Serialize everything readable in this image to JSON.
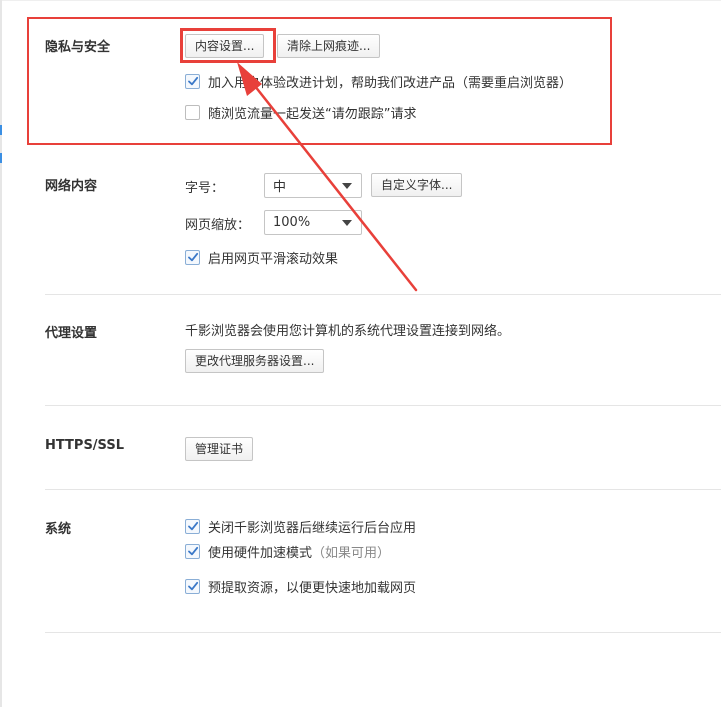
{
  "privacy": {
    "title": "隐私与安全",
    "content_settings_button": "内容设置...",
    "clear_history_button": "清除上网痕迹...",
    "join_program": {
      "label": "加入用户体验改进计划，帮助我们改进产品",
      "note": "（需要重启浏览器）",
      "checked": true
    },
    "do_not_track": {
      "label": "随浏览流量一起发送“请勿跟踪”请求",
      "checked": false
    }
  },
  "web_content": {
    "title": "网络内容",
    "font_size_label": "字号：",
    "font_size_value": "中",
    "custom_font_button": "自定义字体...",
    "zoom_label": "网页缩放：",
    "zoom_value": "100%",
    "smooth_scroll": {
      "label": "启用网页平滑滚动效果",
      "checked": true
    }
  },
  "proxy": {
    "title": "代理设置",
    "description": "千影浏览器会使用您计算机的系统代理设置连接到网络。",
    "change_button": "更改代理服务器设置..."
  },
  "https": {
    "title": "HTTPS/SSL",
    "manage_cert_button": "管理证书"
  },
  "system": {
    "title": "系统",
    "background_apps": {
      "label": "关闭千影浏览器后继续运行后台应用",
      "checked": true
    },
    "hw_accel": {
      "label": "使用硬件加速模式",
      "note": "（如果可用）",
      "checked": true
    },
    "prefetch": {
      "label": "预提取资源，以便更快速地加载网页",
      "checked": true
    }
  },
  "colors": {
    "annotation": "#e8403a",
    "check": "#3a78c8"
  }
}
